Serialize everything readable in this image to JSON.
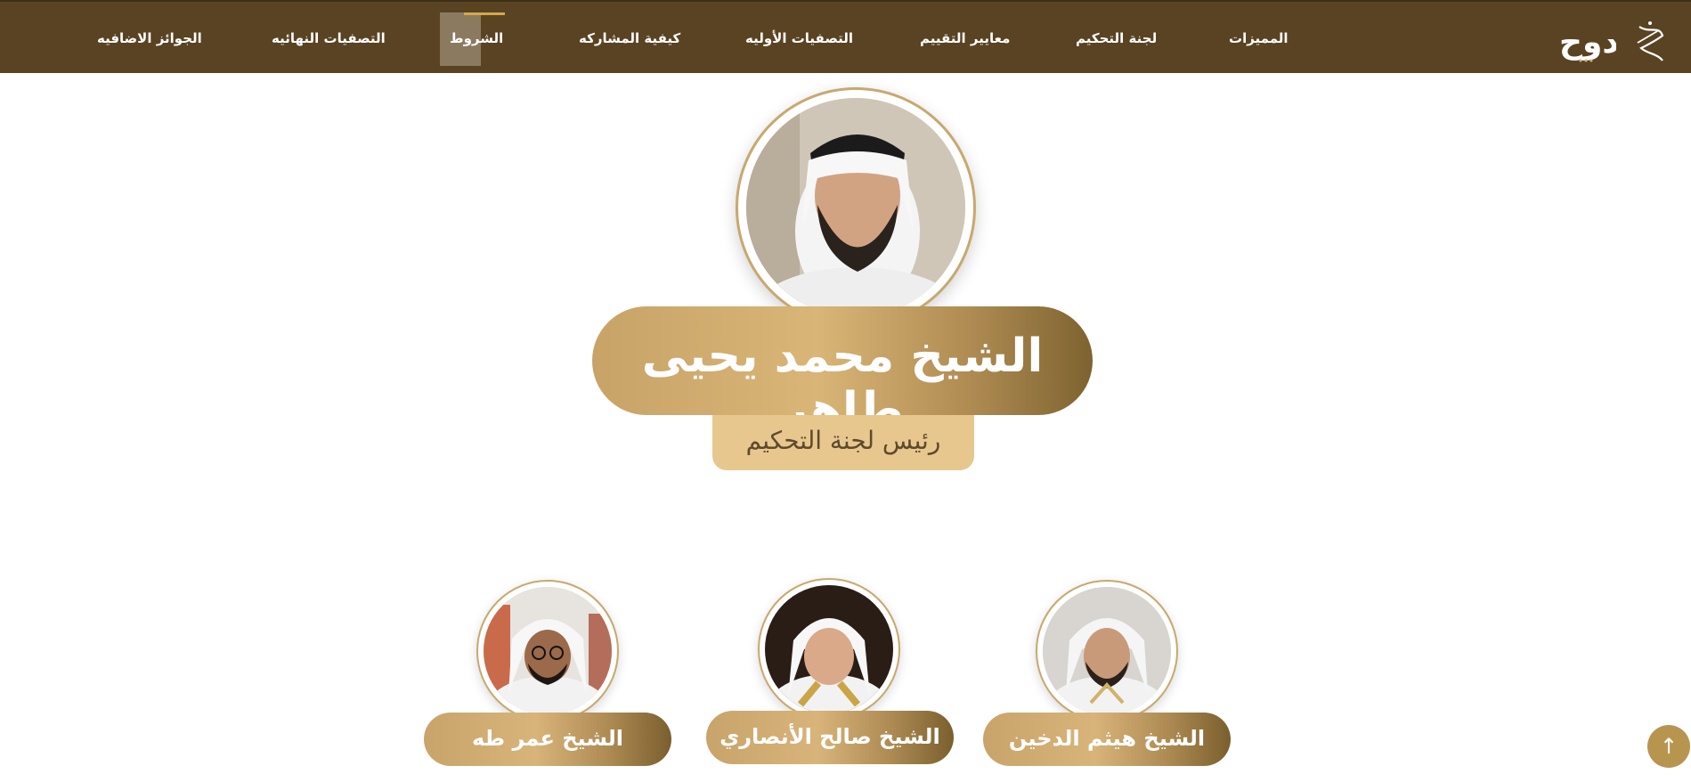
{
  "nav": {
    "items": [
      {
        "label": "المميزات"
      },
      {
        "label": "لجنة التحكيم"
      },
      {
        "label": "معايير التقييم"
      },
      {
        "label": "التصفيات الأوليه"
      },
      {
        "label": "كيفية المشاركه"
      },
      {
        "label": "الشروط"
      },
      {
        "label": "التصفيات النهائيه"
      },
      {
        "label": "الجوائز الاضافيه"
      }
    ],
    "active_index": 5
  },
  "logos": {
    "primary": "دوح",
    "secondary": "logo-calligraphy"
  },
  "head_judge": {
    "name": "الشيخ محمد يحيى طاهر",
    "role": "رئيس لجنة التحكيم"
  },
  "members": [
    {
      "name": "الشيخ هيثم الدخين"
    },
    {
      "name": "الشيخ صالح الأنصاري"
    },
    {
      "name": "الشيخ عمر طه"
    }
  ],
  "back_to_top": "↑",
  "colors": {
    "header": "#5a4322",
    "gold": "#c8a368",
    "role_bg": "#e8c78f"
  }
}
